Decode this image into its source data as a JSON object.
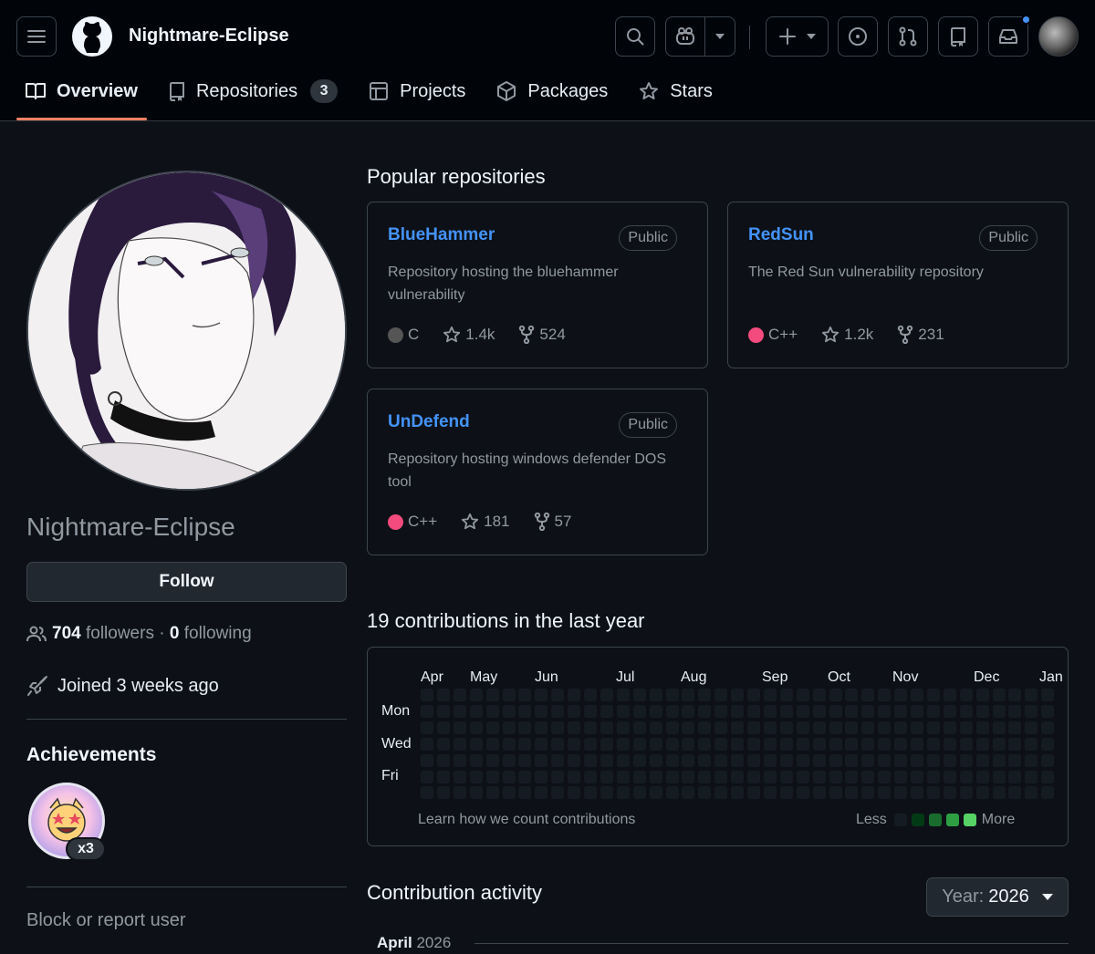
{
  "header": {
    "username": "Nightmare-Eclipse",
    "tabs": [
      {
        "label": "Overview",
        "active": true
      },
      {
        "label": "Repositories",
        "count": "3"
      },
      {
        "label": "Projects"
      },
      {
        "label": "Packages"
      },
      {
        "label": "Stars"
      }
    ]
  },
  "sidebar": {
    "display_name": "Nightmare-Eclipse",
    "follow_label": "Follow",
    "followers_count": "704",
    "followers_label": "followers",
    "separator": "·",
    "following_count": "0",
    "following_label": "following",
    "joined": "Joined 3 weeks ago",
    "achievements_title": "Achievements",
    "achievement_count": "x3",
    "block_label": "Block or report user"
  },
  "popular": {
    "title": "Popular repositories",
    "repos": [
      {
        "name": "BlueHammer",
        "visibility": "Public",
        "description": "Repository hosting the bluehammer vulnerability",
        "language": "C",
        "language_color": "#555555",
        "stars": "1.4k",
        "forks": "524"
      },
      {
        "name": "RedSun",
        "visibility": "Public",
        "description": "The Red Sun vulnerability repository",
        "language": "C++",
        "language_color": "#f34b7d",
        "stars": "1.2k",
        "forks": "231"
      },
      {
        "name": "UnDefend",
        "visibility": "Public",
        "description": "Repository hosting windows defender DOS tool",
        "language": "C++",
        "language_color": "#f34b7d",
        "stars": "181",
        "forks": "57"
      }
    ]
  },
  "contributions": {
    "title": "19 contributions in the last year",
    "months": [
      "Apr",
      "May",
      "Jun",
      "Jul",
      "Aug",
      "Sep",
      "Oct",
      "Nov",
      "Dec",
      "Jan"
    ],
    "days": [
      "Mon",
      "Wed",
      "Fri"
    ],
    "learn_label": "Learn how we count contributions",
    "less_label": "Less",
    "more_label": "More",
    "legend_colors": [
      "#151b23",
      "#033a16",
      "#196c2e",
      "#2ea043",
      "#56d364"
    ]
  },
  "activity": {
    "title": "Contribution activity",
    "year_prefix": "Year:",
    "year_value": "2026",
    "month_label": "April",
    "month_year": "2026"
  }
}
